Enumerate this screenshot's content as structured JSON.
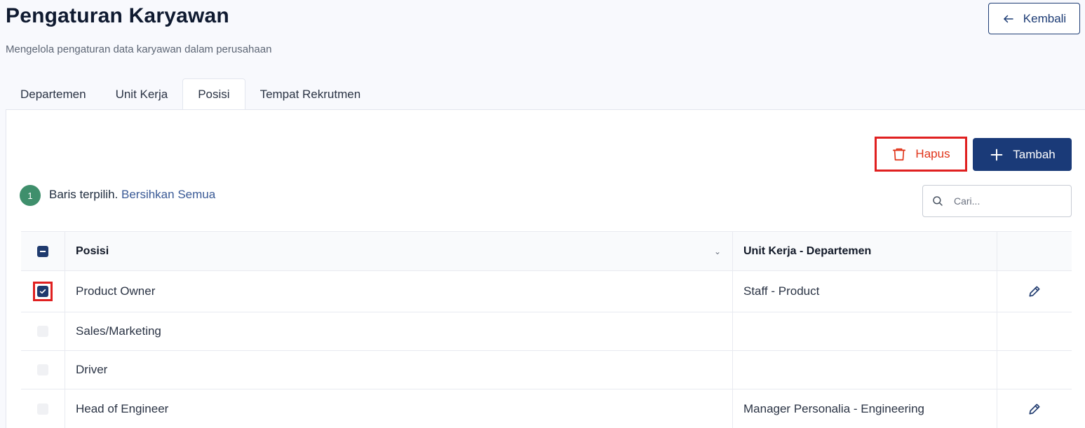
{
  "header": {
    "title": "Pengaturan Karyawan",
    "subtitle": "Mengelola pengaturan data karyawan dalam perusahaan",
    "back_label": "Kembali"
  },
  "tabs": [
    {
      "label": "Departemen",
      "active": false
    },
    {
      "label": "Unit Kerja",
      "active": false
    },
    {
      "label": "Posisi",
      "active": true
    },
    {
      "label": "Tempat Rekrutmen",
      "active": false
    }
  ],
  "toolbar": {
    "delete_label": "Hapus",
    "add_label": "Tambah"
  },
  "selection": {
    "count": "1",
    "text": "Baris terpilih.",
    "clear_label": "Bersihkan Semua"
  },
  "search": {
    "placeholder": "Cari..."
  },
  "table": {
    "columns": [
      "Posisi",
      "Unit Kerja - Departemen"
    ],
    "rows": [
      {
        "posisi": "Product Owner",
        "unit": "Staff - Product",
        "checked": true,
        "editable": true
      },
      {
        "posisi": "Sales/Marketing",
        "unit": "",
        "checked": false,
        "editable": false
      },
      {
        "posisi": "Driver",
        "unit": "",
        "checked": false,
        "editable": false
      },
      {
        "posisi": "Head of Engineer",
        "unit": "Manager Personalia - Engineering",
        "checked": false,
        "editable": true
      }
    ]
  },
  "colors": {
    "primary": "#1a3a78",
    "danger": "#e03318",
    "success": "#3f8f6c",
    "link": "#3a5a96"
  }
}
